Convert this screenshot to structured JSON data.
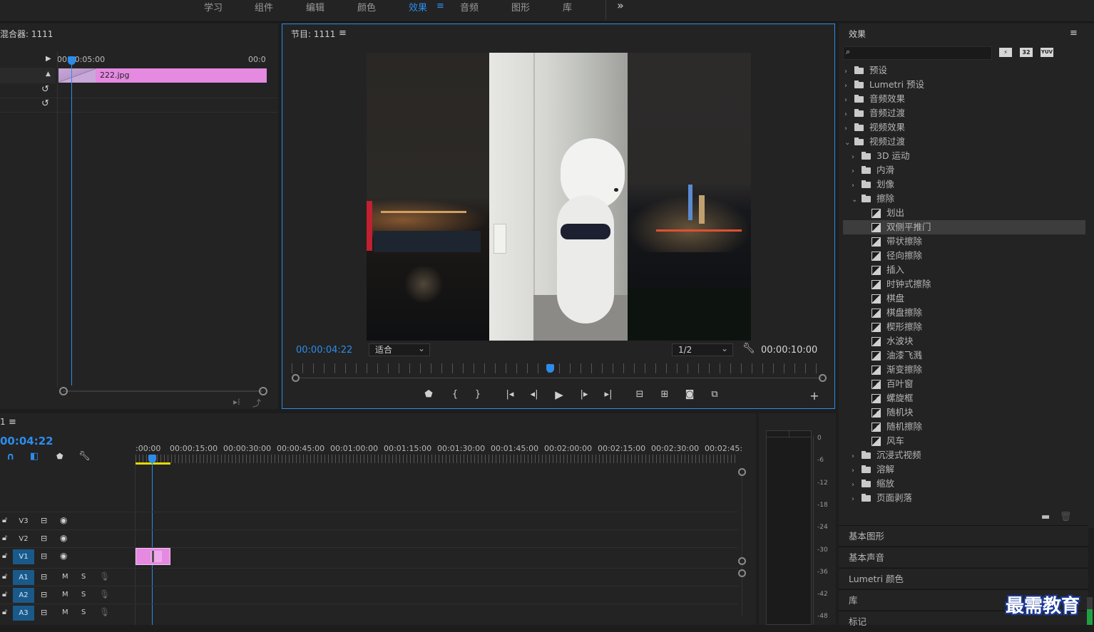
{
  "workspace_tabs": [
    "学习",
    "组件",
    "编辑",
    "颜色",
    "效果",
    "音频",
    "图形",
    "库"
  ],
  "active_tab": "效果",
  "more_icon": "»",
  "audio_mixer": {
    "title": "混合器: 1111",
    "time_start": "00:00:05:00",
    "time_end": "00:0",
    "clip_name": "222.jpg"
  },
  "program_monitor": {
    "title": "节目: 1111",
    "current_tc": "00:00:04:22",
    "fit_label": "适合",
    "resolution": "1/2",
    "duration_tc": "00:00:10:00",
    "progress": 0.48
  },
  "effects_panel": {
    "title": "效果",
    "badges": [
      "32",
      "YUV"
    ],
    "tree": [
      {
        "label": "预设",
        "level": 0,
        "type": "folder2",
        "open": false
      },
      {
        "label": "Lumetri 预设",
        "level": 0,
        "type": "folder2",
        "open": false
      },
      {
        "label": "音频效果",
        "level": 0,
        "type": "folder",
        "open": false
      },
      {
        "label": "音频过渡",
        "level": 0,
        "type": "folder",
        "open": false
      },
      {
        "label": "视频效果",
        "level": 0,
        "type": "folder",
        "open": false
      },
      {
        "label": "视频过渡",
        "level": 0,
        "type": "folder",
        "open": true
      },
      {
        "label": "3D 运动",
        "level": 1,
        "type": "folder",
        "open": false
      },
      {
        "label": "内滑",
        "level": 1,
        "type": "folder",
        "open": false
      },
      {
        "label": "划像",
        "level": 1,
        "type": "folder",
        "open": false
      },
      {
        "label": "擦除",
        "level": 1,
        "type": "folder",
        "open": true
      },
      {
        "label": "划出",
        "level": 2,
        "type": "effect"
      },
      {
        "label": "双侧平推门",
        "level": 2,
        "type": "effect",
        "selected": true
      },
      {
        "label": "带状擦除",
        "level": 2,
        "type": "effect"
      },
      {
        "label": "径向擦除",
        "level": 2,
        "type": "effect"
      },
      {
        "label": "插入",
        "level": 2,
        "type": "effect"
      },
      {
        "label": "时钟式擦除",
        "level": 2,
        "type": "effect"
      },
      {
        "label": "棋盘",
        "level": 2,
        "type": "effect"
      },
      {
        "label": "棋盘擦除",
        "level": 2,
        "type": "effect"
      },
      {
        "label": "楔形擦除",
        "level": 2,
        "type": "effect"
      },
      {
        "label": "水波块",
        "level": 2,
        "type": "effect"
      },
      {
        "label": "油漆飞溅",
        "level": 2,
        "type": "effect"
      },
      {
        "label": "渐变擦除",
        "level": 2,
        "type": "effect"
      },
      {
        "label": "百叶窗",
        "level": 2,
        "type": "effect"
      },
      {
        "label": "螺旋框",
        "level": 2,
        "type": "effect"
      },
      {
        "label": "随机块",
        "level": 2,
        "type": "effect"
      },
      {
        "label": "随机擦除",
        "level": 2,
        "type": "effect"
      },
      {
        "label": "风车",
        "level": 2,
        "type": "effect"
      },
      {
        "label": "沉浸式视频",
        "level": 1,
        "type": "folder",
        "open": false
      },
      {
        "label": "溶解",
        "level": 1,
        "type": "folder",
        "open": false
      },
      {
        "label": "缩放",
        "level": 1,
        "type": "folder",
        "open": false
      },
      {
        "label": "页面剥落",
        "level": 1,
        "type": "folder",
        "open": false
      }
    ],
    "sections": [
      "基本图形",
      "基本声音",
      "Lumetri 颜色",
      "库",
      "标记"
    ]
  },
  "timeline": {
    "sequence_num": "1",
    "current_tc": "00:04:22",
    "ruler": [
      ":00:00",
      "00:00:15:00",
      "00:00:30:00",
      "00:00:45:00",
      "00:01:00:00",
      "00:01:15:00",
      "00:01:30:00",
      "00:01:45:00",
      "00:02:00:00",
      "00:02:15:00",
      "00:02:30:00",
      "00:02:45:"
    ],
    "video_tracks": [
      "V3",
      "V2",
      "V1"
    ],
    "audio_tracks": [
      "A1",
      "A2",
      "A3"
    ],
    "mute_label": "M",
    "solo_label": "S"
  },
  "audio_meter": {
    "scale": [
      "0",
      "-6",
      "-12",
      "-18",
      "-24",
      "-30",
      "-36",
      "-42",
      "-48"
    ]
  },
  "watermark": "最需教育",
  "colors": {
    "accent": "#2d8ceb",
    "clip_pink": "#e58ae0",
    "panel_bg": "#232323",
    "app_bg": "#1d1d1d"
  }
}
